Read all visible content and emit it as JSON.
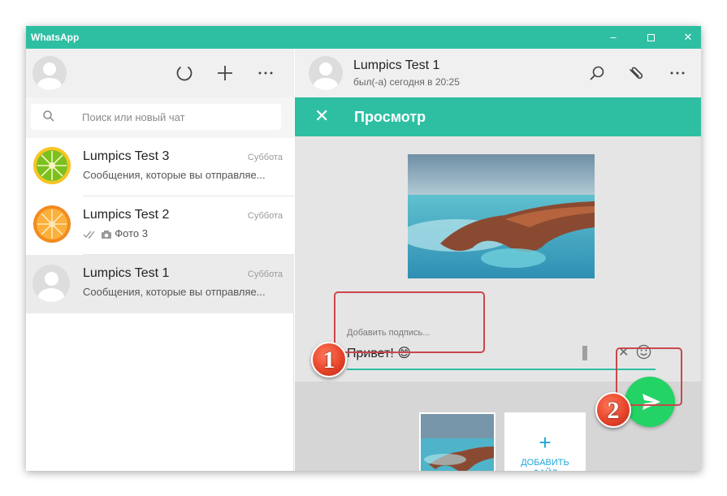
{
  "window": {
    "title": "WhatsApp",
    "minimize": "–",
    "close": "✕"
  },
  "left": {
    "search_placeholder": "Поиск или новый чат",
    "chats": [
      {
        "name": "Lumpics Test 3",
        "date": "Суббота",
        "preview": "Сообщения, которые вы отправляе..."
      },
      {
        "name": "Lumpics Test 2",
        "date": "Суббота",
        "preview": "Фото 3"
      },
      {
        "name": "Lumpics Test 1",
        "date": "Суббота",
        "preview": "Сообщения, которые вы отправляе..."
      }
    ]
  },
  "right": {
    "contact_name": "Lumpics Test 1",
    "contact_status": "был(-а) сегодня в 20:25",
    "preview_close": "✕",
    "preview_title": "Просмотр",
    "caption_hint": "Добавить подпись...",
    "caption_value": "Привет! 😊",
    "caption_clear": "✕",
    "add_file_plus": "+",
    "add_file_label": "ДОБАВИТЬ ФАЙЛ"
  },
  "annotations": {
    "one": "1",
    "two": "2",
    "color": "#c9474c"
  },
  "colors": {
    "accent": "#2ebfa3",
    "send": "#24d366",
    "add_file": "#1fa6d8"
  }
}
